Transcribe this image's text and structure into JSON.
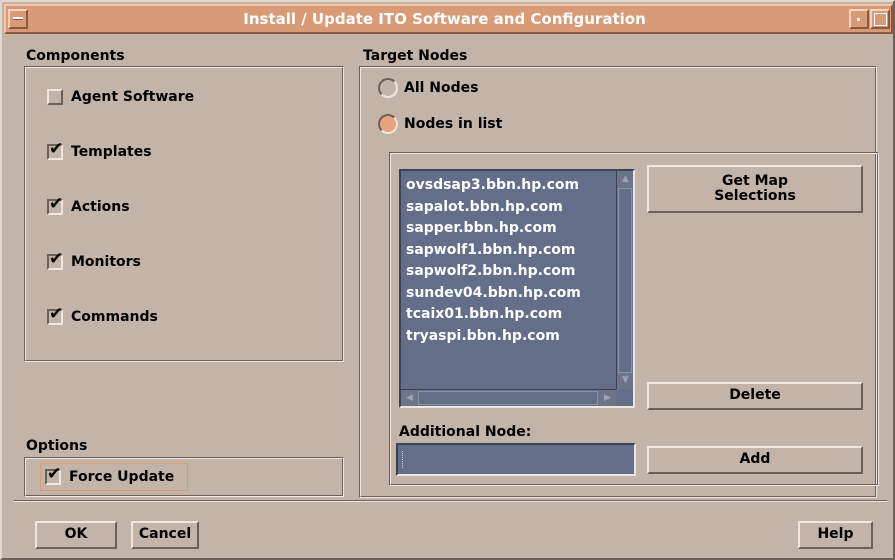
{
  "window": {
    "title": "Install / Update ITO Software and Configuration"
  },
  "components": {
    "heading": "Components",
    "items": [
      {
        "label": "Agent Software",
        "checked": false
      },
      {
        "label": "Templates",
        "checked": true
      },
      {
        "label": "Actions",
        "checked": true
      },
      {
        "label": "Monitors",
        "checked": true
      },
      {
        "label": "Commands",
        "checked": true
      }
    ]
  },
  "options": {
    "heading": "Options",
    "force_update": {
      "label": "Force Update",
      "checked": true
    }
  },
  "target_nodes": {
    "heading": "Target Nodes",
    "radio_all": {
      "label": "All Nodes",
      "selected": false
    },
    "radio_list": {
      "label": "Nodes in list",
      "selected": true
    },
    "nodes": [
      "ovsdsap3.bbn.hp.com",
      "sapalot.bbn.hp.com",
      "sapper.bbn.hp.com",
      "sapwolf1.bbn.hp.com",
      "sapwolf2.bbn.hp.com",
      "sundev04.bbn.hp.com",
      "tcaix01.bbn.hp.com",
      "tryaspi.bbn.hp.com"
    ],
    "get_map_label_line1": "Get Map",
    "get_map_label_line2": "Selections",
    "delete_label": "Delete",
    "additional_node_label": "Additional Node:",
    "additional_node_value": "",
    "add_label": "Add"
  },
  "footer": {
    "ok_label": "OK",
    "cancel_label": "Cancel",
    "help_label": "Help"
  },
  "colors": {
    "background": "#c4b4a8",
    "titlebar": "#d99a78",
    "list_bg": "#636e89",
    "radio_selected": "#e5a47c"
  }
}
